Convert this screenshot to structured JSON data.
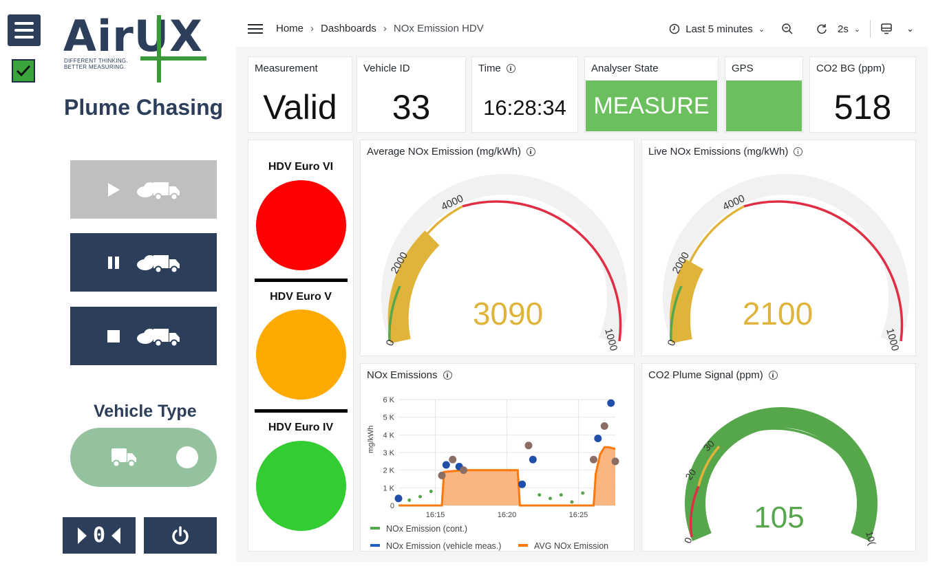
{
  "left_panel": {
    "logo_text": "AirUX",
    "logo_tagline_1": "DIFFERENT THINKING.",
    "logo_tagline_2": "BETTER MEASURING.",
    "title": "Plume Chasing",
    "vehicle_type_title": "Vehicle Type",
    "reset_label": "0",
    "buttons": [
      "play-truck",
      "pause-truck",
      "stop-truck"
    ],
    "check_state": "checked"
  },
  "navbar": {
    "breadcrumb": [
      "Home",
      "Dashboards",
      "NOx Emission HDV"
    ],
    "time_range": "Last 5 minutes",
    "refresh_interval": "2s"
  },
  "stats": {
    "measurement": {
      "title": "Measurement",
      "value": "Valid"
    },
    "vehicle_id": {
      "title": "Vehicle ID",
      "value": "33"
    },
    "time": {
      "title": "Time",
      "value": "16:28:34"
    },
    "analyser_state": {
      "title": "Analyser State",
      "value": "MEASURE"
    },
    "gps": {
      "title": "GPS",
      "value": ""
    },
    "co2_bg": {
      "title": "CO2 BG (ppm)",
      "value": "518"
    }
  },
  "euro_classes": [
    {
      "label": "HDV Euro VI",
      "color": "#ff0000"
    },
    {
      "label": "HDV Euro V",
      "color": "#ffaa00"
    },
    {
      "label": "HDV Euro IV",
      "color": "#33cc33"
    }
  ],
  "gauges": {
    "avg_nox": {
      "title": "Average NOx Emission (mg/kWh)",
      "value": "3090",
      "ticks": [
        "0",
        "2000",
        "4000",
        "1000"
      ],
      "color": "#e0b43a"
    },
    "live_nox": {
      "title": "Live NOx Emissions (mg/kWh)",
      "value": "2100",
      "ticks": [
        "0",
        "2000",
        "4000",
        "1000"
      ],
      "color": "#e0b43a"
    },
    "co2_plume": {
      "title": "CO2 Plume Signal (ppm)",
      "value": "105",
      "ticks": [
        "0",
        "20",
        "30",
        "10("
      ],
      "color": "#56a64b"
    }
  },
  "nox_chart": {
    "title": "NOx Emissions",
    "ylabel": "mg/kWh",
    "y_ticks": [
      "0",
      "1 K",
      "2 K",
      "3 K",
      "4 K",
      "5 K",
      "6 K"
    ],
    "x_ticks": [
      "16:15",
      "16:20",
      "16:25"
    ],
    "legend": [
      "NOx Emission (cont.)",
      "NOx Emission (vehicle meas.)",
      "AVG NOx Emission"
    ],
    "legend_colors": [
      "#56a64b",
      "#1f60c4",
      "#ff780a"
    ]
  },
  "chart_data": {
    "type": "line",
    "title": "NOx Emissions",
    "ylabel": "mg/kWh",
    "ylim": [
      0,
      6000
    ],
    "x_ticks": [
      "16:15",
      "16:20",
      "16:25"
    ],
    "series": [
      {
        "name": "AVG NOx Emission",
        "x": [
          0.0,
          0.1,
          0.17,
          0.2,
          0.21,
          0.3,
          0.55,
          0.56,
          0.62,
          0.65,
          0.66,
          0.9,
          0.91,
          0.93,
          0.95,
          0.97,
          1.0
        ],
        "values": [
          0,
          0,
          0,
          0,
          1900,
          2000,
          2000,
          0,
          0,
          0,
          0,
          0,
          1800,
          2900,
          3300,
          3300,
          3200
        ]
      },
      {
        "name": "NOx Emission (vehicle meas.)",
        "x": [
          0.0,
          0.2,
          0.22,
          0.25,
          0.28,
          0.3,
          0.57,
          0.6,
          0.62,
          0.9,
          0.92,
          0.95,
          0.98,
          1.0
        ],
        "values": [
          400,
          1700,
          2300,
          2600,
          2200,
          2000,
          1200,
          3400,
          2600,
          2600,
          3800,
          4500,
          5800,
          2500
        ]
      },
      {
        "name": "NOx Emission (cont.)",
        "x": [
          0.05,
          0.1,
          0.15,
          0.65,
          0.7,
          0.75,
          0.8,
          0.85
        ],
        "values": [
          300,
          500,
          800,
          600,
          400,
          600,
          200,
          700
        ]
      }
    ]
  }
}
